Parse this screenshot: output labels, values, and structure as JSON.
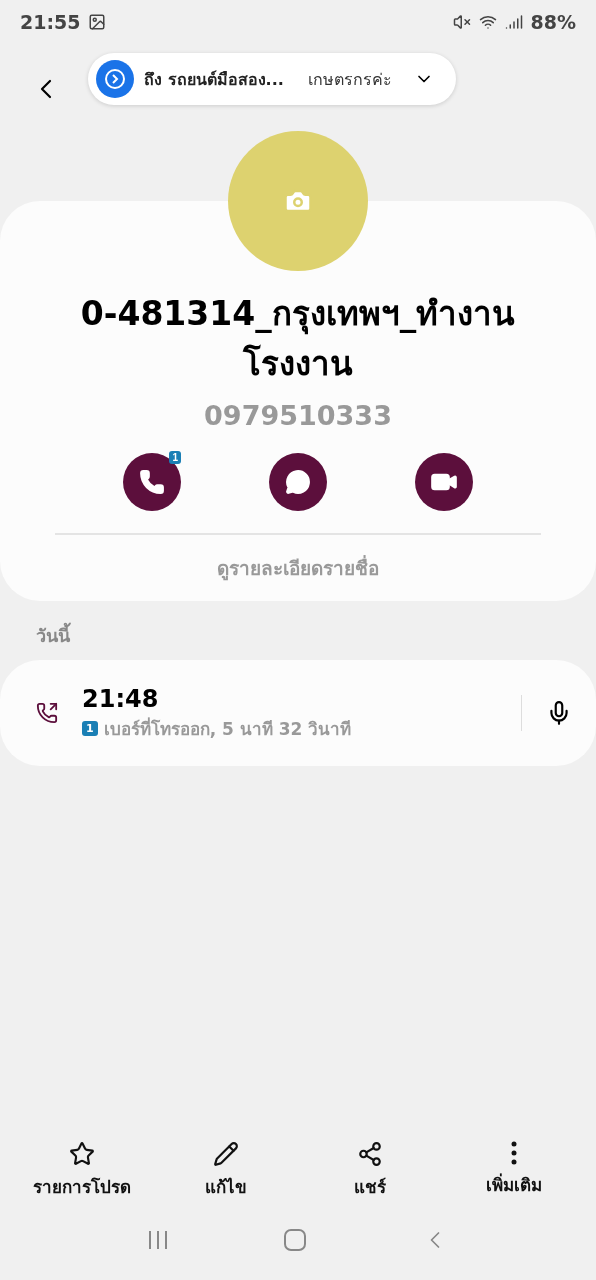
{
  "status_bar": {
    "time": "21:55",
    "battery": "88%"
  },
  "notification": {
    "title": "ถึง รถยนต์มือสอง...",
    "subtitle": "เกษตรกรค่ะ"
  },
  "contact": {
    "name": "0-481314_กรุงเทพฯ_ทำงาน\nโรงงาน",
    "phone": "0979510333",
    "actions": [
      {
        "kind": "call",
        "badge": "1"
      },
      {
        "kind": "message"
      },
      {
        "kind": "video"
      }
    ],
    "details_link": "ดูรายละเอียดรายชื่อ"
  },
  "history": {
    "heading": "วันนี้",
    "calls": [
      {
        "time": "21:48",
        "sim": "1",
        "description": "เบอร์ที่โทรออก, 5 นาที 32 วินาที"
      }
    ]
  },
  "bottom_actions": [
    {
      "kind": "favorite",
      "label": "รายการโปรด"
    },
    {
      "kind": "edit",
      "label": "แก้ไข"
    },
    {
      "kind": "share",
      "label": "แชร์"
    },
    {
      "kind": "more",
      "label": "เพิ่มเติม"
    }
  ]
}
